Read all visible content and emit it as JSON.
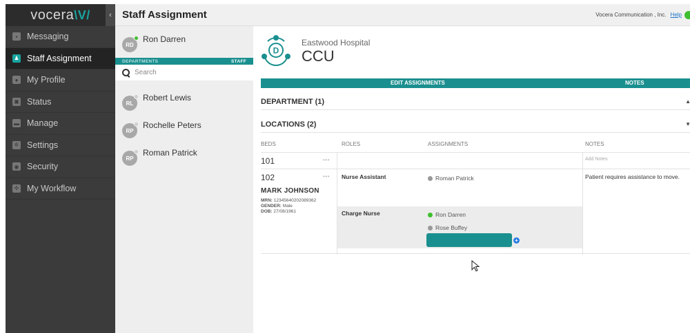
{
  "brand": {
    "text": "vocera",
    "mark": "\\V/",
    "collapse_icon": "chevron-left-icon"
  },
  "sidebar": {
    "items": [
      {
        "label": "Messaging",
        "icon": "message-icon",
        "active": false
      },
      {
        "label": "Staff Assignment",
        "icon": "staff-icon",
        "active": true
      },
      {
        "label": "My Profile",
        "icon": "profile-icon",
        "active": false
      },
      {
        "label": "Status",
        "icon": "status-icon",
        "active": false
      },
      {
        "label": "Manage",
        "icon": "manage-icon",
        "active": false
      },
      {
        "label": "Settings",
        "icon": "gear-icon",
        "active": false
      },
      {
        "label": "Security",
        "icon": "shield-icon",
        "active": false
      },
      {
        "label": "My Workflow",
        "icon": "workflow-icon",
        "active": false
      }
    ]
  },
  "header": {
    "title": "Staff Assignment",
    "company": "Vocera Communication , Inc.",
    "help": "Help",
    "status_color": "#3fbf2f"
  },
  "staff_panel": {
    "current_user": {
      "initials": "RD",
      "name": "Ron Darren",
      "online": true
    },
    "tabs": {
      "departments": "DEPARTMENTS",
      "staff": "STAFF"
    },
    "search_placeholder": "Search",
    "staff": [
      {
        "initials": "RL",
        "name": "Robert Lewis"
      },
      {
        "initials": "RP",
        "name": "Rochelle Peters"
      },
      {
        "initials": "RP",
        "name": "Roman Patrick"
      }
    ]
  },
  "main": {
    "logo_letter": "D",
    "hospital": "Eastwood Hospital",
    "unit": "CCU",
    "actions": {
      "edit": "EDIT ASSIGNMENTS",
      "notes": "NOTES"
    },
    "sections": {
      "department": "DEPARTMENT (1)",
      "locations": "LOCATIONS (2)"
    },
    "columns": {
      "beds": "BEDS",
      "roles": "ROLES",
      "assignments": "ASSIGNMENTS",
      "notes": "NOTES"
    },
    "rows": [
      {
        "bed": "101",
        "dots": "•••",
        "notes_placeholder": "Add Notes"
      },
      {
        "bed": "102",
        "dots": "•••",
        "patient": {
          "name": "MARK JOHNSON",
          "mrn_label": "MRN:",
          "mrn": "12345640202089362",
          "gender_label": "GENDER:",
          "gender": "Male",
          "dob_label": "DOB:",
          "dob": "27/08/1961"
        },
        "roles": [
          {
            "role": "Nurse Assistant",
            "assignees": [
              {
                "name": "Roman Patrick",
                "status": "offline"
              }
            ]
          },
          {
            "role": "Charge Nurse",
            "assignees": [
              {
                "name": "Ron Darren",
                "status": "online"
              },
              {
                "name": "Rose Buffey",
                "status": "offline"
              }
            ]
          }
        ],
        "note": "Patient requires assistance to move."
      }
    ],
    "accent_color": "#1a8f8f"
  }
}
